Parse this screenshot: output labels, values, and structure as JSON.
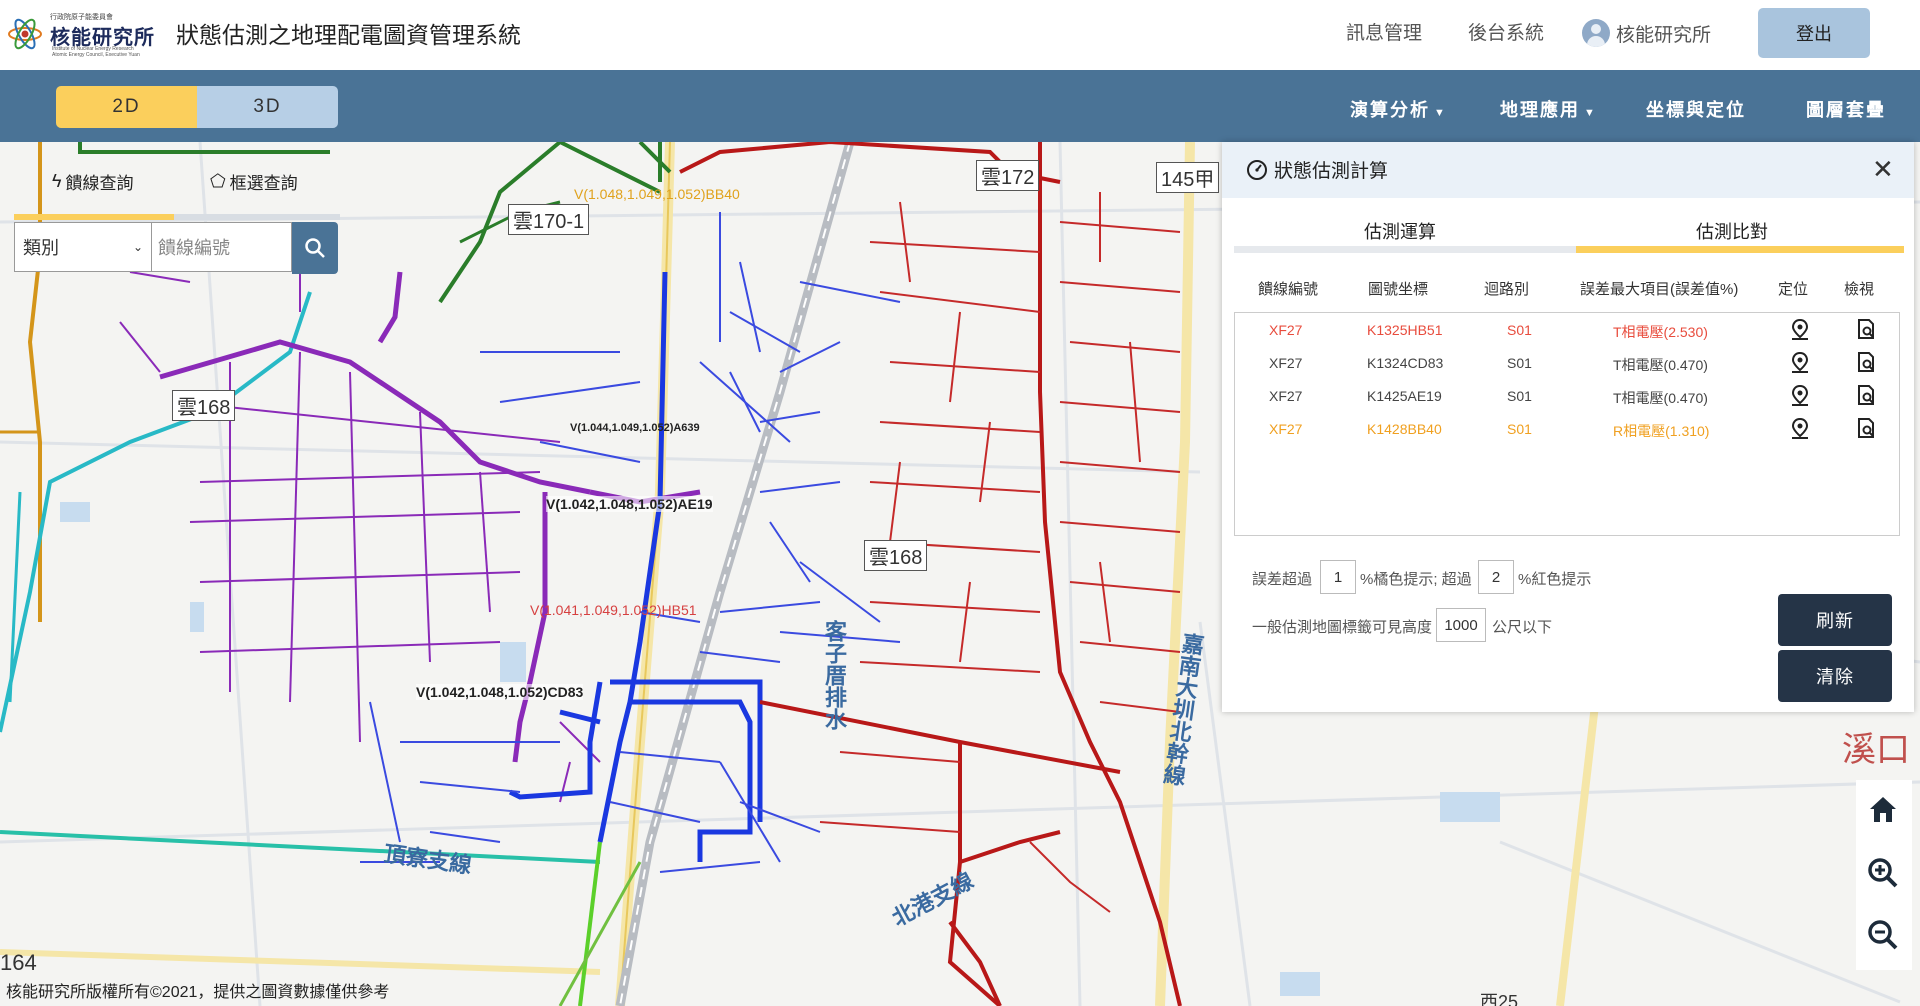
{
  "header": {
    "logo_small": "行政院原子能委員會",
    "logo_name": "核能研究所",
    "logo_en1": "Institute of Nuclear Energy Research",
    "logo_en2": "Atomic Energy Council, Executive Yuan",
    "app_title": "狀態估測之地理配電圖資管理系統",
    "links": [
      "訊息管理",
      "後台系統"
    ],
    "user_name": "核能研究所",
    "logout_label": "登出"
  },
  "navbar": {
    "mode_2d": "2D",
    "mode_3d": "3D",
    "menus": [
      "演算分析",
      "地理應用",
      "坐標與定位",
      "圖層套疊"
    ]
  },
  "query": {
    "tab_feeder": "饋線查詢",
    "tab_box": "框選查詢",
    "select_value": "類別",
    "input_placeholder": "饋線編號"
  },
  "map": {
    "labels": [
      {
        "text": "V(1.048,1.049,1.052)BB40",
        "color": "#e0a21c"
      },
      {
        "text": "V(1.044,1.049,1.052)A639",
        "color": "#222222"
      },
      {
        "text": "V(1.042,1.048,1.052)AE19",
        "color": "#222222"
      },
      {
        "text": "V(1.041,1.049,1.052)HB51",
        "color": "#d64040"
      },
      {
        "text": "V(1.042,1.048,1.052)CD83",
        "color": "#222222"
      }
    ],
    "road_labels": [
      "雲172",
      "145甲",
      "雲170-1",
      "雲168",
      "雲168",
      "頂寮支線",
      "北港支線",
      "客子厝排水",
      "嘉南大圳北幹線",
      "溪口",
      "164",
      "西25"
    ],
    "copyright": "核能研究所版權所有©2021，提供之圖資數據僅供參考"
  },
  "panel": {
    "title": "狀態估測計算",
    "tab_calc": "估測運算",
    "tab_compare": "估測比對",
    "columns": [
      "饋線編號",
      "圖號坐標",
      "迴路別",
      "誤差最大項目(誤差值%)",
      "定位",
      "檢視"
    ],
    "rows": [
      {
        "feeder": "XF27",
        "coord": "K1325HB51",
        "loop": "S01",
        "max_error": "T相電壓(2.530)",
        "color": "#e84c3d"
      },
      {
        "feeder": "XF27",
        "coord": "K1324CD83",
        "loop": "S01",
        "max_error": "T相電壓(0.470)",
        "color": "#444444"
      },
      {
        "feeder": "XF27",
        "coord": "K1425AE19",
        "loop": "S01",
        "max_error": "T相電壓(0.470)",
        "color": "#444444"
      },
      {
        "feeder": "XF27",
        "coord": "K1428BB40",
        "loop": "S01",
        "max_error": "R相電壓(1.310)",
        "color": "#f0a020"
      }
    ],
    "threshold": {
      "prefix": "誤差超過",
      "orange_value": "1",
      "orange_text": "%橘色提示; 超過",
      "red_value": "2",
      "red_text": "%紅色提示"
    },
    "height": {
      "prefix": "一般估測地圖標籤可見高度",
      "value": "1000",
      "suffix": "公尺以下"
    },
    "refresh_label": "刷新",
    "clear_label": "清除"
  }
}
